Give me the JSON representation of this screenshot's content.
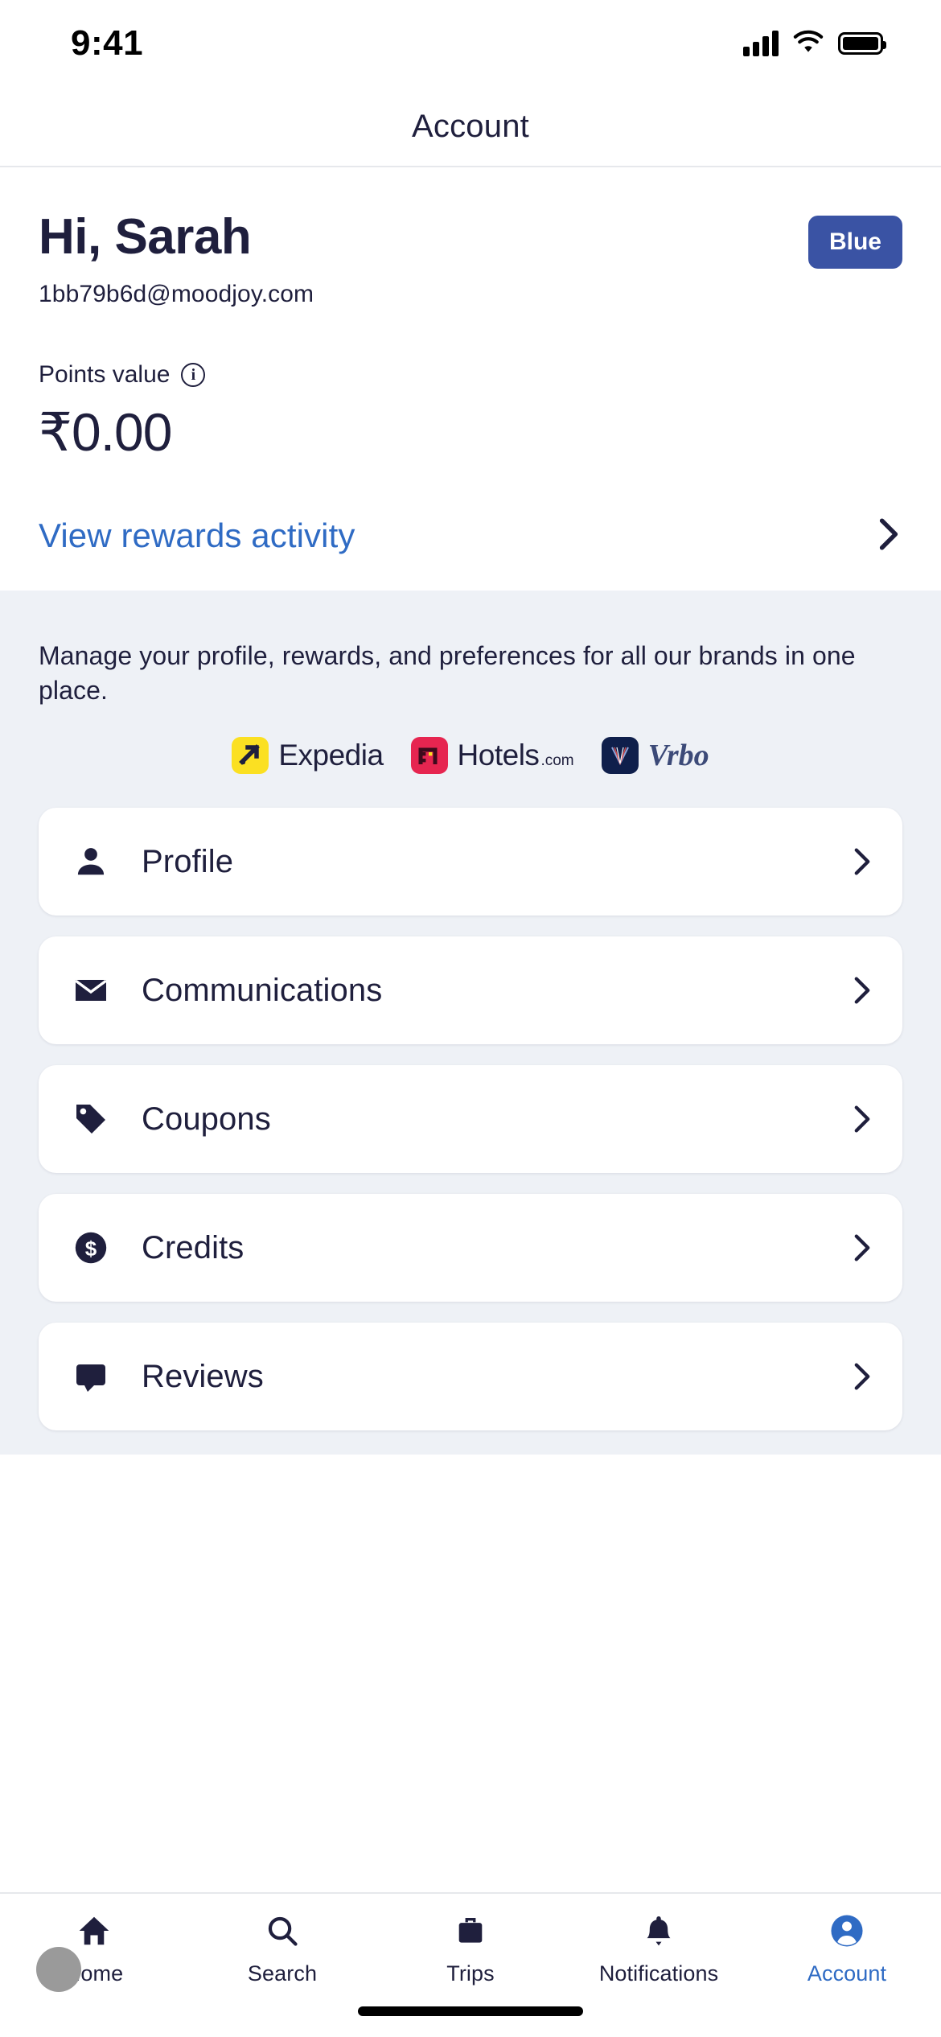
{
  "status_bar": {
    "time": "9:41",
    "icons": [
      "cellular-signal-icon",
      "wifi-icon",
      "battery-icon"
    ]
  },
  "nav": {
    "title": "Account"
  },
  "hero": {
    "greeting": "Hi, Sarah",
    "email": "1bb79b6d@moodjoy.com",
    "tier_badge": "Blue",
    "tier_badge_color": "#3a53a4",
    "points_label": "Points value",
    "points_info_icon": "info-icon",
    "points_value": "₹0.00",
    "rewards_link": "View rewards activity",
    "rewards_link_color": "#2f6bc4"
  },
  "manage_section": {
    "description": "Manage your profile, rewards, and preferences for all our brands in one place.",
    "brands": [
      {
        "name": "Expedia",
        "suffix": "",
        "mark": "expedia-logo-icon",
        "mark_color": "#fbe022"
      },
      {
        "name": "Hotels",
        "suffix": ".com",
        "mark": "hotels-logo-icon",
        "mark_color": "#e62550"
      },
      {
        "name": "Vrbo",
        "suffix": "",
        "mark": "vrbo-logo-icon",
        "mark_color": "#0f1f4b"
      }
    ]
  },
  "menu": {
    "items": [
      {
        "label": "Profile",
        "icon": "person-icon"
      },
      {
        "label": "Communications",
        "icon": "envelope-icon"
      },
      {
        "label": "Coupons",
        "icon": "tag-icon"
      },
      {
        "label": "Credits",
        "icon": "dollar-circle-icon"
      },
      {
        "label": "Reviews",
        "icon": "review-icon"
      }
    ],
    "chevron_icon": "chevron-right-icon"
  },
  "tabbar": {
    "tabs": [
      {
        "label": "Home",
        "icon": "house-icon",
        "active": false
      },
      {
        "label": "Search",
        "icon": "magnifier-icon",
        "active": false
      },
      {
        "label": "Trips",
        "icon": "suitcase-icon",
        "active": false
      },
      {
        "label": "Notifications",
        "icon": "bell-icon",
        "active": false
      },
      {
        "label": "Account",
        "icon": "account-circle-icon",
        "active": true
      }
    ],
    "active_color": "#2f6bc4",
    "inactive_color": "#1f1f3d"
  }
}
